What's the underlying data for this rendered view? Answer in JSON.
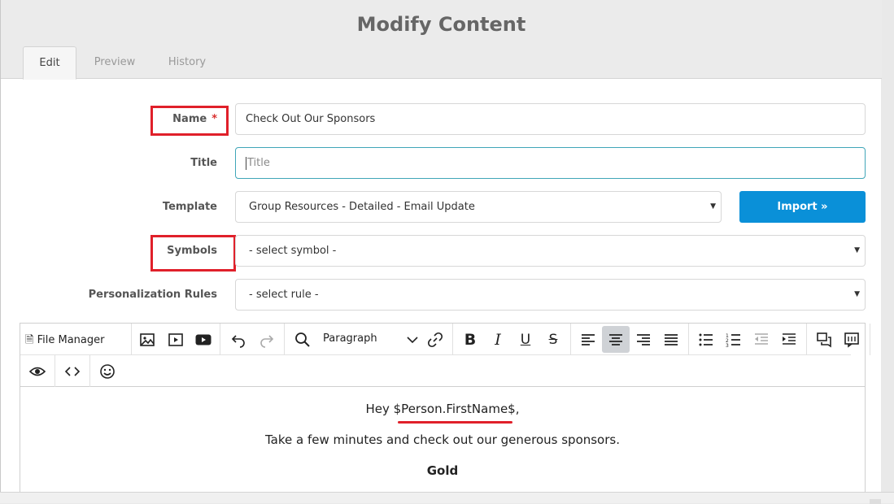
{
  "dialog": {
    "title": "Modify Content",
    "tabs": [
      {
        "label": "Edit",
        "active": true
      },
      {
        "label": "Preview",
        "active": false
      },
      {
        "label": "History",
        "active": false
      }
    ]
  },
  "form": {
    "name_label": "Name",
    "required_mark": "*",
    "name_value": "Check Out Our Sponsors",
    "title_label": "Title",
    "title_placeholder": "Title",
    "template_label": "Template",
    "template_value": "Group Resources - Detailed - Email Update",
    "import_label": "Import »",
    "symbols_label": "Symbols",
    "symbols_value": "- select symbol -",
    "rules_label": "Personalization Rules",
    "rules_value": "- select rule -"
  },
  "editor": {
    "file_manager_label": "File Manager",
    "paragraph_label": "Paragraph",
    "content": {
      "greeting_prefix": "Hey ",
      "greeting_token": "$Person.FirstName$",
      "greeting_suffix": ",",
      "line2": "Take a few minutes and check out our generous sponsors.",
      "heading": "Gold"
    }
  },
  "colors": {
    "accent": "#0a90d8",
    "highlight_box": "#e0202a",
    "focus_border": "#40a6b8"
  }
}
